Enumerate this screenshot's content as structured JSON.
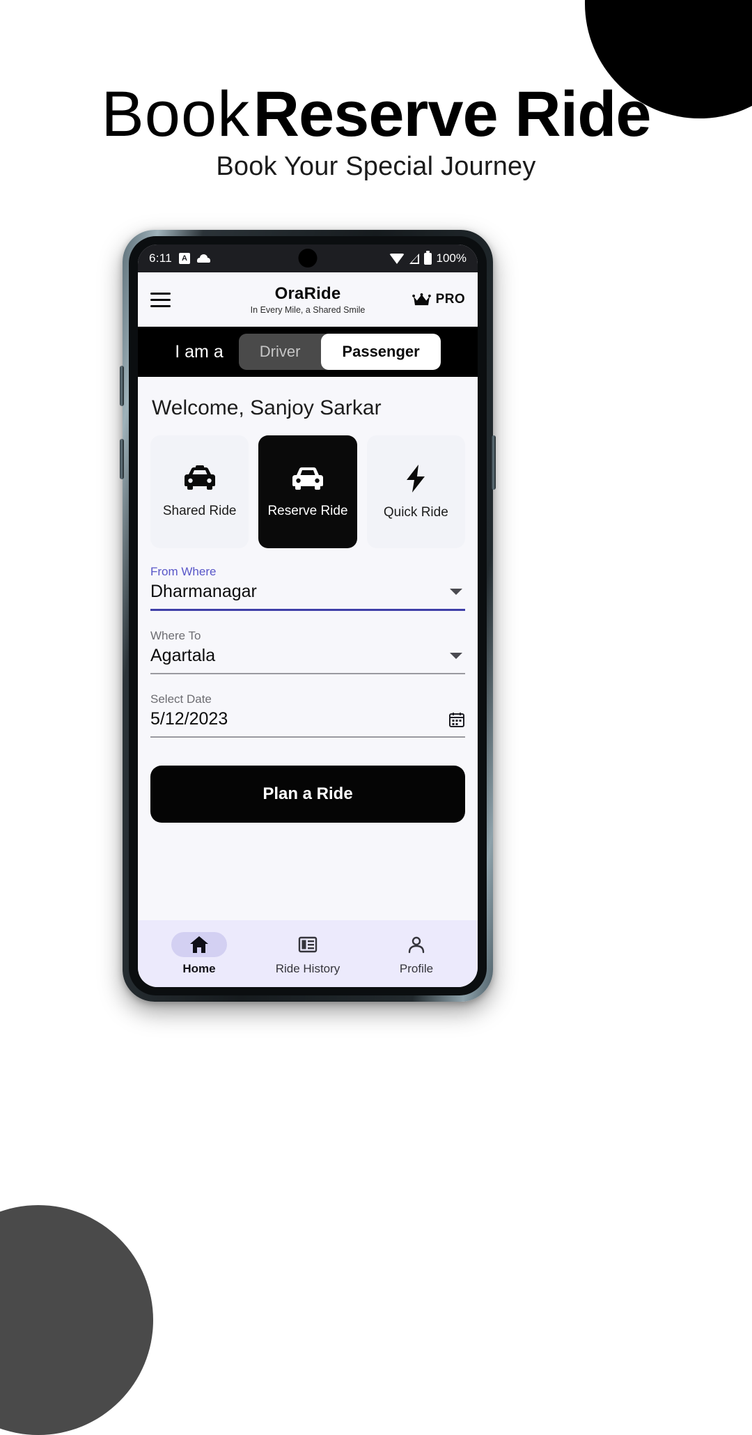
{
  "promo": {
    "headline_light": "Book",
    "headline_bold": "Reserve Ride",
    "subhead": "Book Your Special Journey"
  },
  "phone": {
    "statusbar": {
      "time": "6:11",
      "icon_a_label": "A",
      "icons_left": [
        "notification-a-icon",
        "cloud-icon"
      ],
      "icons_right": [
        "wifi-icon",
        "signal-icon",
        "battery-icon"
      ],
      "battery_percent": "100%"
    },
    "appbar": {
      "menu_icon": "hamburger-icon",
      "brand": "OraRide",
      "tagline": "In Every Mile, a Shared Smile",
      "pro_icon": "crown-icon",
      "pro_label": "PRO"
    },
    "rolebar": {
      "label": "I am a",
      "options": [
        {
          "label": "Driver",
          "active": false
        },
        {
          "label": "Passenger",
          "active": true
        }
      ]
    },
    "welcome": "Welcome, Sanjoy Sarkar",
    "ride_types": [
      {
        "label": "Shared Ride",
        "icon": "taxi-icon",
        "selected": false
      },
      {
        "label": "Reserve Ride",
        "icon": "car-icon",
        "selected": true
      },
      {
        "label": "Quick Ride",
        "icon": "bolt-icon",
        "selected": false
      }
    ],
    "form": {
      "from": {
        "label": "From Where",
        "value": "Dharmanagar",
        "icon": "chevron-down-icon",
        "focused": true
      },
      "to": {
        "label": "Where To",
        "value": "Agartala",
        "icon": "chevron-down-icon",
        "focused": false
      },
      "date": {
        "label": "Select Date",
        "value": "5/12/2023",
        "icon": "calendar-icon",
        "focused": false
      }
    },
    "cta": "Plan a Ride",
    "bottomnav": [
      {
        "label": "Home",
        "icon": "home-icon",
        "active": true
      },
      {
        "label": "Ride History",
        "icon": "list-icon",
        "active": false
      },
      {
        "label": "Profile",
        "icon": "person-icon",
        "active": false
      }
    ]
  },
  "colors": {
    "accent_focus": "#5856c8",
    "dark": "#0a0a0a",
    "nav_bg": "#eceafc",
    "nav_pill": "#d3d0f2"
  }
}
